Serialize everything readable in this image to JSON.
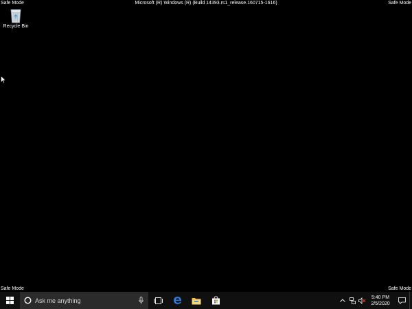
{
  "watermark": {
    "safe_mode_top_left": "Safe Mode",
    "safe_mode_top_right": "Safe Mode",
    "safe_mode_bottom_left": "Safe Mode",
    "safe_mode_bottom_right": "Safe Mode",
    "build": "Microsoft (R) Windows (R) (Build 14393.rs1_release.160715-1616)"
  },
  "desktop": {
    "icons": [
      {
        "label": "Recycle Bin",
        "icon": "recycle-bin-icon"
      }
    ]
  },
  "taskbar": {
    "start_icon": "windows-logo-icon",
    "search": {
      "placeholder": "Ask me anything",
      "icon": "cortana-circle-icon",
      "mic_icon": "microphone-icon"
    },
    "pinned": [
      {
        "name": "task-view",
        "icon": "task-view-icon"
      },
      {
        "name": "edge",
        "icon": "edge-icon"
      },
      {
        "name": "file-explorer",
        "icon": "folder-icon"
      },
      {
        "name": "store",
        "icon": "store-bag-icon"
      }
    ],
    "tray": {
      "chevron_icon": "chevron-up-icon",
      "network_icon": "network-icon",
      "volume_icon": "speaker-muted-icon",
      "time": "5:40 PM",
      "date": "2/5/2020",
      "notification_icon": "action-center-icon"
    }
  },
  "colors": {
    "desktop_bg": "#000000",
    "taskbar_bg": "#101010",
    "search_bg": "#2b2b2b",
    "edge_blue": "#2f7bd9",
    "folder_yellow": "#f2c44f",
    "volume_red": "#e03131"
  }
}
